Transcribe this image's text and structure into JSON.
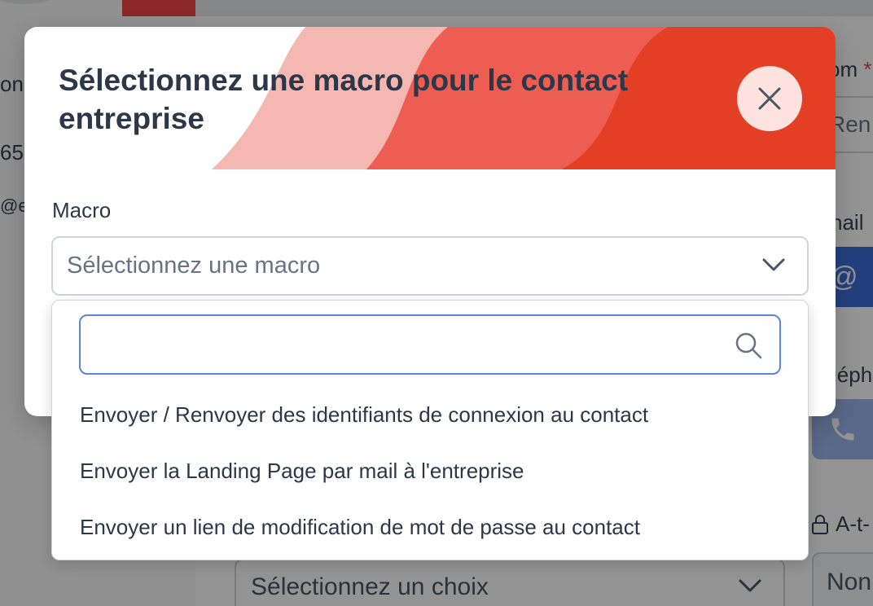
{
  "background": {
    "left_column": [
      "on",
      "65",
      "@e"
    ],
    "right_column": {
      "nom_label": "om",
      "required_mark": "*",
      "nom_value": "Ren",
      "email_label": "nail",
      "email_button_icon": "@",
      "phone_label": "léph",
      "phone_button_icon": "phone-icon",
      "lock_row_label": "A-t-",
      "select_placeholder": "Sélectionnez un choix",
      "non_value": "Non"
    }
  },
  "modal": {
    "title": "Sélectionnez une macro pour le contact entreprise",
    "close_icon": "close-icon",
    "field_label": "Macro",
    "select_placeholder": "Sélectionnez une macro",
    "search_value": "",
    "options": [
      "Envoyer / Renvoyer des identifiants de connexion au contact",
      "Envoyer la Landing Page par mail à l'entreprise",
      "Envoyer un lien de modification de mot de passe au contact"
    ]
  },
  "colors": {
    "banner_light": "#f5b7b1",
    "banner_mid": "#ee5d51",
    "banner_dark": "#e23f25",
    "close_bg": "#fde2e0",
    "search_border": "#5b87d8"
  }
}
